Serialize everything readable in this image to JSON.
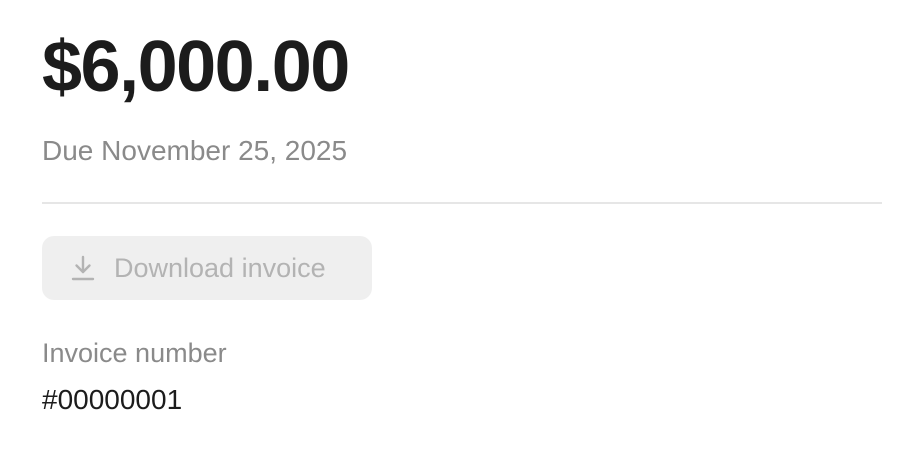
{
  "invoice": {
    "amount": "$6,000.00",
    "due_text": "Due November 25, 2025",
    "download_button": {
      "label": "Download invoice",
      "icon": "download-icon",
      "state": "disabled"
    },
    "number_label": "Invoice number",
    "number_value": "#00000001"
  },
  "colors": {
    "primary_text": "#1c1c1c",
    "secondary_text": "#8a8a8a",
    "disabled_text": "#b3b3b3",
    "button_background": "#efefef",
    "divider": "#e6e6e6"
  }
}
